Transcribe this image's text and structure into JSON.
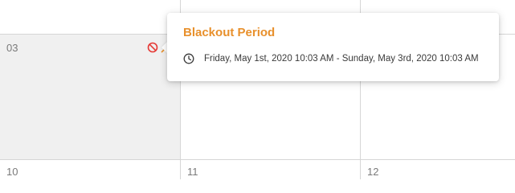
{
  "calendar": {
    "cells": {
      "c03": "03",
      "c10": "10",
      "c11": "11",
      "c12": "12"
    }
  },
  "popover": {
    "title": "Blackout Period",
    "time_range": "Friday, May 1st, 2020 10:03 AM - Sunday, May 3rd, 2020 10:03 AM"
  },
  "colors": {
    "title_accent": "#e8902c",
    "blocked_icon": "#e53935",
    "grid_line": "#d6d6d6",
    "shaded_cell": "#f0f0f0"
  },
  "icons": {
    "blocked": "blocked-icon",
    "clock": "clock-icon"
  }
}
